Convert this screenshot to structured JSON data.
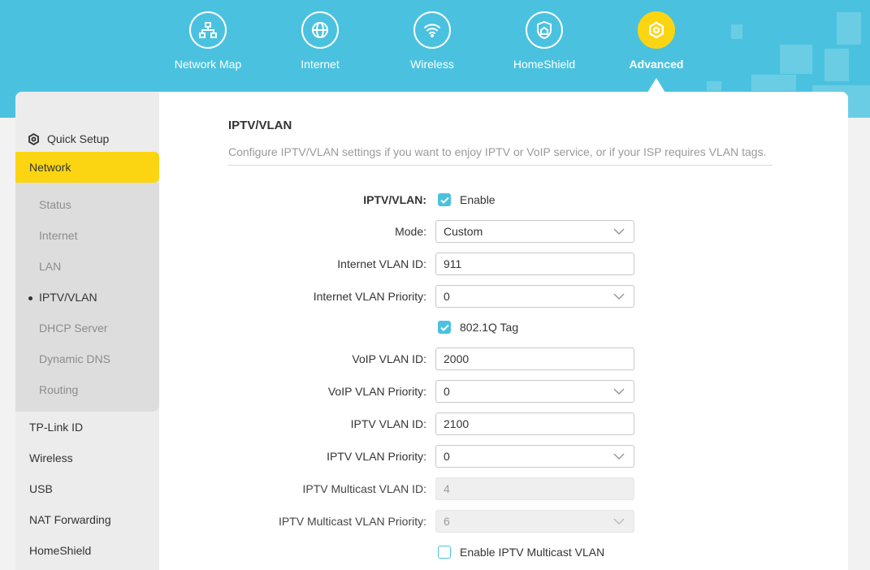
{
  "colors": {
    "header_bg": "#4ac2df",
    "accent_yellow": "#fbd512",
    "checkbox_blue": "#4ac2df"
  },
  "top_nav": [
    {
      "label": "Network Map",
      "icon": "network-map-icon",
      "active": false
    },
    {
      "label": "Internet",
      "icon": "globe-icon",
      "active": false
    },
    {
      "label": "Wireless",
      "icon": "wifi-icon",
      "active": false
    },
    {
      "label": "HomeShield",
      "icon": "homeshield-icon",
      "active": false
    },
    {
      "label": "Advanced",
      "icon": "gear-icon",
      "active": true
    }
  ],
  "sidebar": {
    "quick_setup": "Quick Setup",
    "network": "Network",
    "network_sub": [
      "Status",
      "Internet",
      "LAN",
      "IPTV/VLAN",
      "DHCP Server",
      "Dynamic DNS",
      "Routing"
    ],
    "active_sub": "IPTV/VLAN",
    "items": [
      "TP-Link ID",
      "Wireless",
      "USB",
      "NAT Forwarding",
      "HomeShield"
    ]
  },
  "page": {
    "title": "IPTV/VLAN",
    "description": "Configure IPTV/VLAN settings if you want to enjoy IPTV or VoIP service, or if your ISP requires VLAN tags."
  },
  "form": {
    "iptv_vlan_label": "IPTV/VLAN:",
    "enable_label": "Enable",
    "enable_checked": true,
    "mode_label": "Mode:",
    "mode_value": "Custom",
    "internet_vlan_id_label": "Internet VLAN ID:",
    "internet_vlan_id_value": "911",
    "internet_vlan_priority_label": "Internet VLAN Priority:",
    "internet_vlan_priority_value": "0",
    "tag_label": "802.1Q Tag",
    "tag_checked": true,
    "voip_vlan_id_label": "VoIP VLAN ID:",
    "voip_vlan_id_value": "2000",
    "voip_vlan_priority_label": "VoIP VLAN Priority:",
    "voip_vlan_priority_value": "0",
    "iptv_vlan_id_label": "IPTV VLAN ID:",
    "iptv_vlan_id_value": "2100",
    "iptv_vlan_priority_label": "IPTV VLAN Priority:",
    "iptv_vlan_priority_value": "0",
    "iptv_multicast_vlan_id_label": "IPTV Multicast VLAN ID:",
    "iptv_multicast_vlan_id_value": "4",
    "iptv_multicast_vlan_priority_label": "IPTV Multicast VLAN Priority:",
    "iptv_multicast_vlan_priority_value": "6",
    "enable_multicast_label": "Enable IPTV Multicast VLAN",
    "enable_multicast_checked": false
  }
}
